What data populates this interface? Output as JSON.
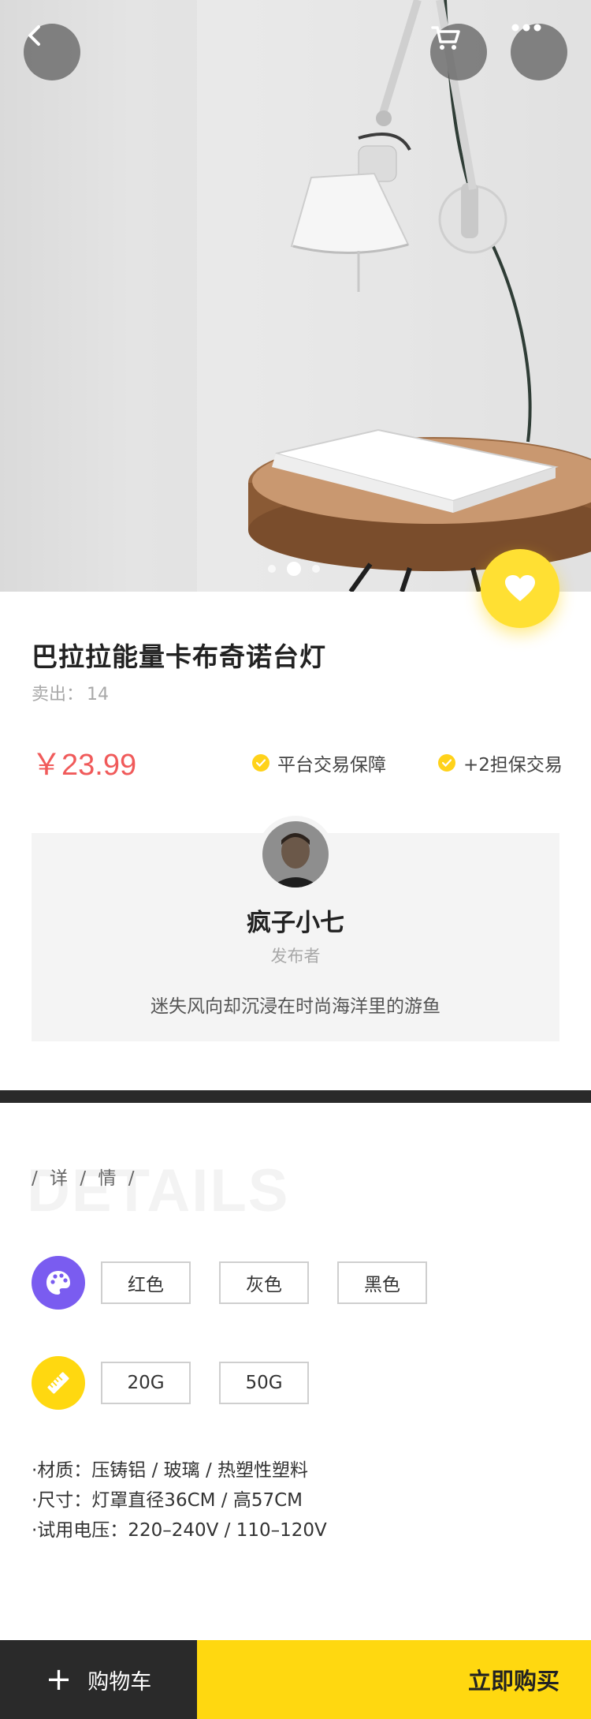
{
  "product": {
    "title": "巴拉拉能量卡布奇诺台灯",
    "sold_label": "卖出：",
    "sold_count": "14",
    "price": "￥23.99",
    "guarantees": [
      "平台交易保障",
      "+2担保交易"
    ]
  },
  "gallery": {
    "dot_count": 3,
    "active_index": 1
  },
  "seller": {
    "name": "疯子小七",
    "role": "发布者",
    "bio": "迷失风向却沉浸在时尚海洋里的游鱼"
  },
  "details": {
    "bg_title": "DETAILS",
    "title": "/ 详 / 情 /",
    "colors": [
      "红色",
      "灰色",
      "黑色"
    ],
    "sizes": [
      "20G",
      "50G"
    ],
    "specs": [
      "·材质：压铸铝 / 玻璃 / 热塑性塑料",
      "·尺寸：灯罩直径36CM / 高57CM",
      "·试用电压：220–240V / 110–120V"
    ]
  },
  "bottom_bar": {
    "cart_label": "购物车",
    "buy_label": "立即购买"
  },
  "icons": {
    "back": "chevron-left-icon",
    "cart": "cart-icon",
    "more": "more-icon",
    "favorite": "heart-icon",
    "color": "palette-icon",
    "size": "ruler-icon",
    "add": "plus-icon"
  },
  "colors": {
    "accent_yellow": "#ffd810",
    "price_red": "#f05a5a",
    "palette_purple": "#7a5cf0",
    "dark": "#2a2a2a"
  }
}
